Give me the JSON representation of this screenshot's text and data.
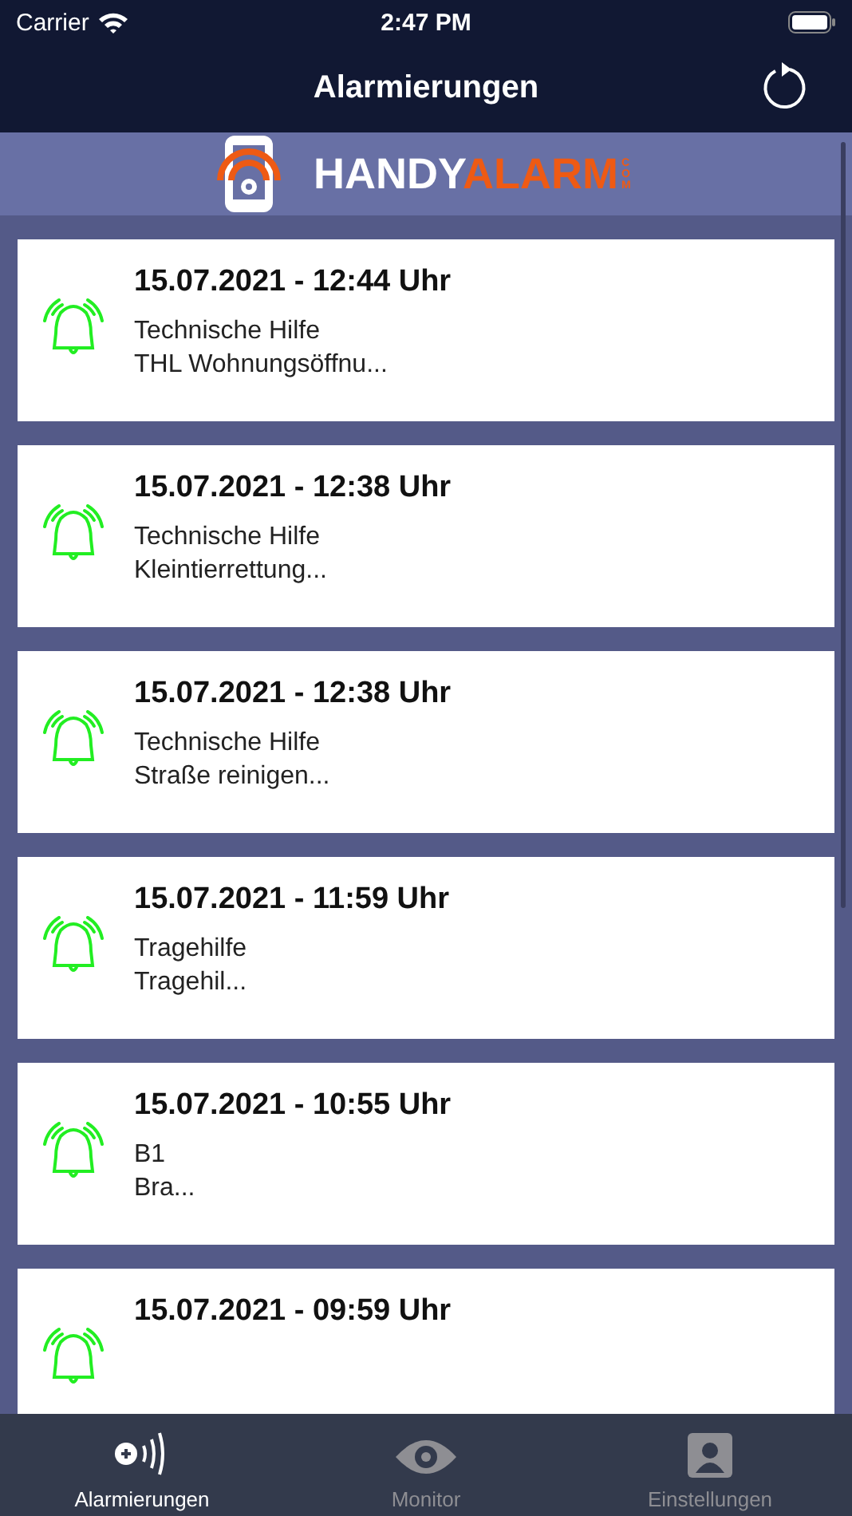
{
  "status_bar": {
    "carrier": "Carrier",
    "time": "2:47 PM"
  },
  "nav_bar": {
    "title": "Alarmierungen"
  },
  "logo": {
    "first": "HANDY",
    "second": "ALARM",
    "suffix": "COM"
  },
  "alarms": [
    {
      "datetime": "15.07.2021 - 12:44 Uhr",
      "type": "Technische Hilfe",
      "detail": "THL Wohnungsöffnu..."
    },
    {
      "datetime": "15.07.2021 - 12:38 Uhr",
      "type": "Technische Hilfe",
      "detail": "Kleintierrettung..."
    },
    {
      "datetime": "15.07.2021 - 12:38 Uhr",
      "type": "Technische Hilfe",
      "detail": "Straße reinigen..."
    },
    {
      "datetime": "15.07.2021 - 11:59 Uhr",
      "type": "Tragehilfe",
      "detail": "Tragehil..."
    },
    {
      "datetime": "15.07.2021 - 10:55 Uhr",
      "type": "B1",
      "detail": "Bra..."
    },
    {
      "datetime": "15.07.2021 - 09:59 Uhr"
    }
  ],
  "tab_bar": [
    {
      "label": "Alarmierungen",
      "kind": "alarm",
      "selected": true
    },
    {
      "label": "Monitor",
      "kind": "eye",
      "selected": false
    },
    {
      "label": "Einstellungen",
      "kind": "person",
      "selected": false
    }
  ]
}
